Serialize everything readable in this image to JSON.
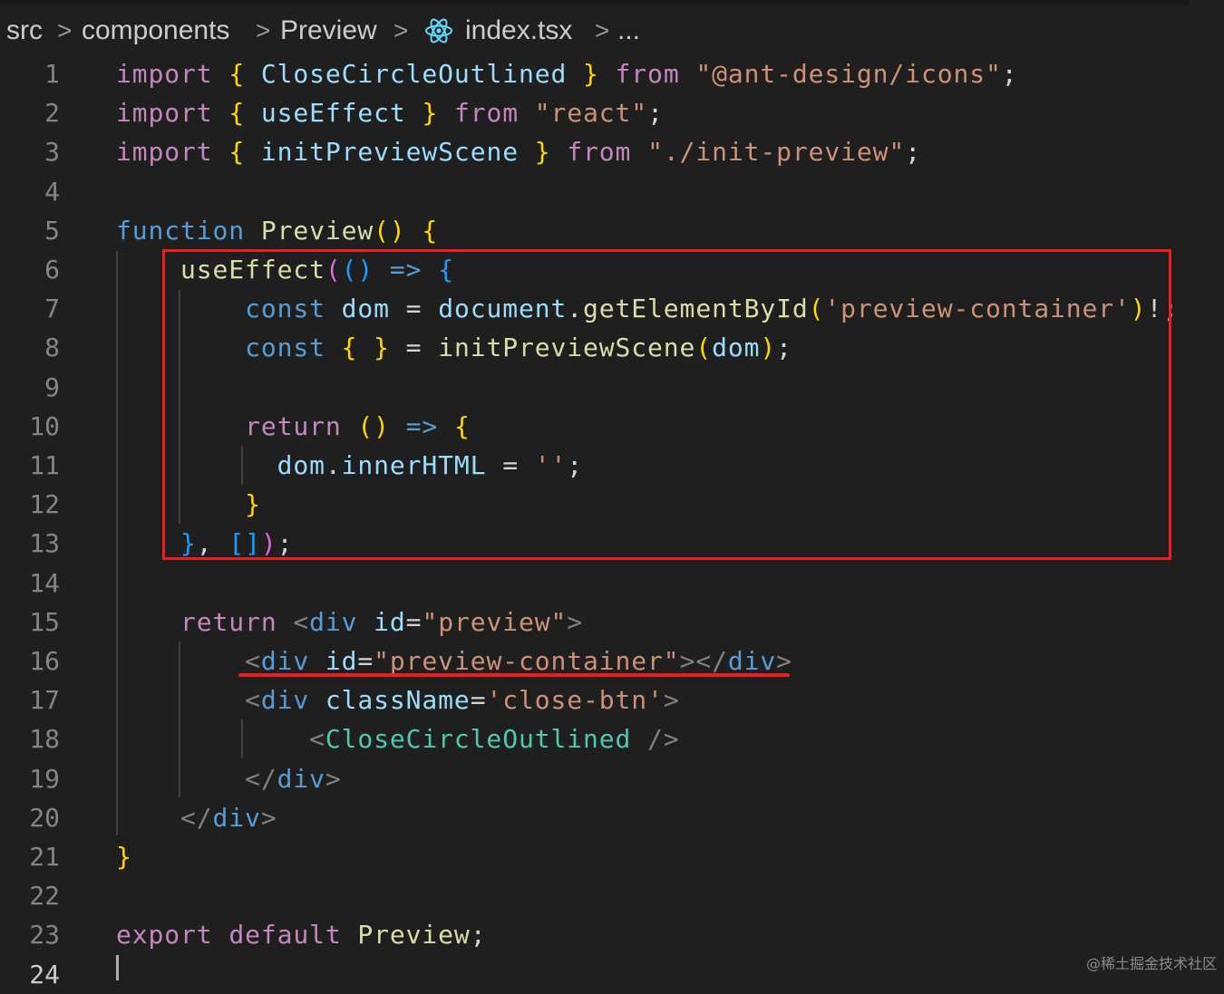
{
  "breadcrumb": {
    "segments": [
      "src",
      "components",
      "Preview",
      "index.tsx",
      "..."
    ],
    "separator": ">",
    "file_icon": "react-icon"
  },
  "editor": {
    "line_numbers": [
      "1",
      "2",
      "3",
      "4",
      "5",
      "6",
      "7",
      "8",
      "9",
      "10",
      "11",
      "12",
      "13",
      "14",
      "15",
      "16",
      "17",
      "18",
      "19",
      "20",
      "21",
      "22",
      "23",
      "24"
    ],
    "active_line": "24",
    "lines": [
      [
        [
          "kw",
          "import"
        ],
        [
          "p",
          " "
        ],
        [
          "b1",
          "{"
        ],
        [
          "p",
          " "
        ],
        [
          "var",
          "CloseCircleOutlined"
        ],
        [
          "p",
          " "
        ],
        [
          "b1",
          "}"
        ],
        [
          "p",
          " "
        ],
        [
          "kw",
          "from"
        ],
        [
          "p",
          " "
        ],
        [
          "str",
          "\"@ant-design/icons\""
        ],
        [
          "p",
          ";"
        ]
      ],
      [
        [
          "kw",
          "import"
        ],
        [
          "p",
          " "
        ],
        [
          "b1",
          "{"
        ],
        [
          "p",
          " "
        ],
        [
          "var",
          "useEffect"
        ],
        [
          "p",
          " "
        ],
        [
          "b1",
          "}"
        ],
        [
          "p",
          " "
        ],
        [
          "kw",
          "from"
        ],
        [
          "p",
          " "
        ],
        [
          "str",
          "\"react\""
        ],
        [
          "p",
          ";"
        ]
      ],
      [
        [
          "kw",
          "import"
        ],
        [
          "p",
          " "
        ],
        [
          "b1",
          "{"
        ],
        [
          "p",
          " "
        ],
        [
          "var",
          "initPreviewScene"
        ],
        [
          "p",
          " "
        ],
        [
          "b1",
          "}"
        ],
        [
          "p",
          " "
        ],
        [
          "kw",
          "from"
        ],
        [
          "p",
          " "
        ],
        [
          "str",
          "\"./init-preview\""
        ],
        [
          "p",
          ";"
        ]
      ],
      [],
      [
        [
          "st",
          "function"
        ],
        [
          "p",
          " "
        ],
        [
          "fn",
          "Preview"
        ],
        [
          "b1",
          "()"
        ],
        [
          "p",
          " "
        ],
        [
          "b1",
          "{"
        ]
      ],
      [
        [
          "p",
          "    "
        ],
        [
          "fn",
          "useEffect"
        ],
        [
          "b2",
          "("
        ],
        [
          "b3",
          "()"
        ],
        [
          "p",
          " "
        ],
        [
          "st",
          "=>"
        ],
        [
          "p",
          " "
        ],
        [
          "b3",
          "{"
        ]
      ],
      [
        [
          "p",
          "        "
        ],
        [
          "st",
          "const"
        ],
        [
          "p",
          " "
        ],
        [
          "var",
          "dom"
        ],
        [
          "p",
          " = "
        ],
        [
          "var",
          "document"
        ],
        [
          "p",
          "."
        ],
        [
          "fn",
          "getElementById"
        ],
        [
          "b1",
          "("
        ],
        [
          "str",
          "'preview-container'"
        ],
        [
          "b1",
          ")"
        ],
        [
          "p",
          "!;"
        ]
      ],
      [
        [
          "p",
          "        "
        ],
        [
          "st",
          "const"
        ],
        [
          "p",
          " "
        ],
        [
          "b1",
          "{ }"
        ],
        [
          "p",
          " = "
        ],
        [
          "fn",
          "initPreviewScene"
        ],
        [
          "b1",
          "("
        ],
        [
          "var",
          "dom"
        ],
        [
          "b1",
          ")"
        ],
        [
          "p",
          ";"
        ]
      ],
      [],
      [
        [
          "p",
          "        "
        ],
        [
          "kw",
          "return"
        ],
        [
          "p",
          " "
        ],
        [
          "b1",
          "()"
        ],
        [
          "p",
          " "
        ],
        [
          "st",
          "=>"
        ],
        [
          "p",
          " "
        ],
        [
          "b1",
          "{"
        ]
      ],
      [
        [
          "p",
          "          "
        ],
        [
          "var",
          "dom"
        ],
        [
          "p",
          "."
        ],
        [
          "var",
          "innerHTML"
        ],
        [
          "p",
          " = "
        ],
        [
          "str",
          "''"
        ],
        [
          "p",
          ";"
        ]
      ],
      [
        [
          "p",
          "        "
        ],
        [
          "b1",
          "}"
        ]
      ],
      [
        [
          "p",
          "    "
        ],
        [
          "b3",
          "}"
        ],
        [
          "p",
          ", "
        ],
        [
          "b3",
          "[]"
        ],
        [
          "b2",
          ")"
        ],
        [
          "p",
          ";"
        ]
      ],
      [],
      [
        [
          "p",
          "    "
        ],
        [
          "kw",
          "return"
        ],
        [
          "p",
          " "
        ],
        [
          "tag",
          "<"
        ],
        [
          "st",
          "div"
        ],
        [
          "p",
          " "
        ],
        [
          "var",
          "id"
        ],
        [
          "p",
          "="
        ],
        [
          "str",
          "\"preview\""
        ],
        [
          "tag",
          ">"
        ]
      ],
      [
        [
          "p",
          "        "
        ],
        [
          "tag",
          "<"
        ],
        [
          "st",
          "div"
        ],
        [
          "p",
          " "
        ],
        [
          "var",
          "id"
        ],
        [
          "p",
          "="
        ],
        [
          "str",
          "\"preview-container\""
        ],
        [
          "tag",
          "></"
        ],
        [
          "st",
          "div"
        ],
        [
          "tag",
          ">"
        ]
      ],
      [
        [
          "p",
          "        "
        ],
        [
          "tag",
          "<"
        ],
        [
          "st",
          "div"
        ],
        [
          "p",
          " "
        ],
        [
          "var",
          "className"
        ],
        [
          "p",
          "="
        ],
        [
          "str",
          "'close-btn'"
        ],
        [
          "tag",
          ">"
        ]
      ],
      [
        [
          "p",
          "            "
        ],
        [
          "tag",
          "<"
        ],
        [
          "ty",
          "CloseCircleOutlined"
        ],
        [
          "p",
          " "
        ],
        [
          "tag",
          "/>"
        ]
      ],
      [
        [
          "p",
          "        "
        ],
        [
          "tag",
          "</"
        ],
        [
          "st",
          "div"
        ],
        [
          "tag",
          ">"
        ]
      ],
      [
        [
          "p",
          "    "
        ],
        [
          "tag",
          "</"
        ],
        [
          "st",
          "div"
        ],
        [
          "tag",
          ">"
        ]
      ],
      [
        [
          "b1",
          "}"
        ]
      ],
      [],
      [
        [
          "kw",
          "export"
        ],
        [
          "p",
          " "
        ],
        [
          "kw",
          "default"
        ],
        [
          "p",
          " "
        ],
        [
          "fn",
          "Preview"
        ],
        [
          "p",
          ";"
        ]
      ],
      []
    ]
  },
  "watermark": "@稀土掘金技术社区",
  "colors": {
    "background": "#1f1f1f",
    "highlight_annotation": "#f01d1d",
    "keyword": "#c586c0",
    "storage": "#569cd6",
    "function": "#dcdcaa",
    "variable": "#9cdcfe",
    "string": "#ce9178",
    "component": "#4ec9b0"
  }
}
